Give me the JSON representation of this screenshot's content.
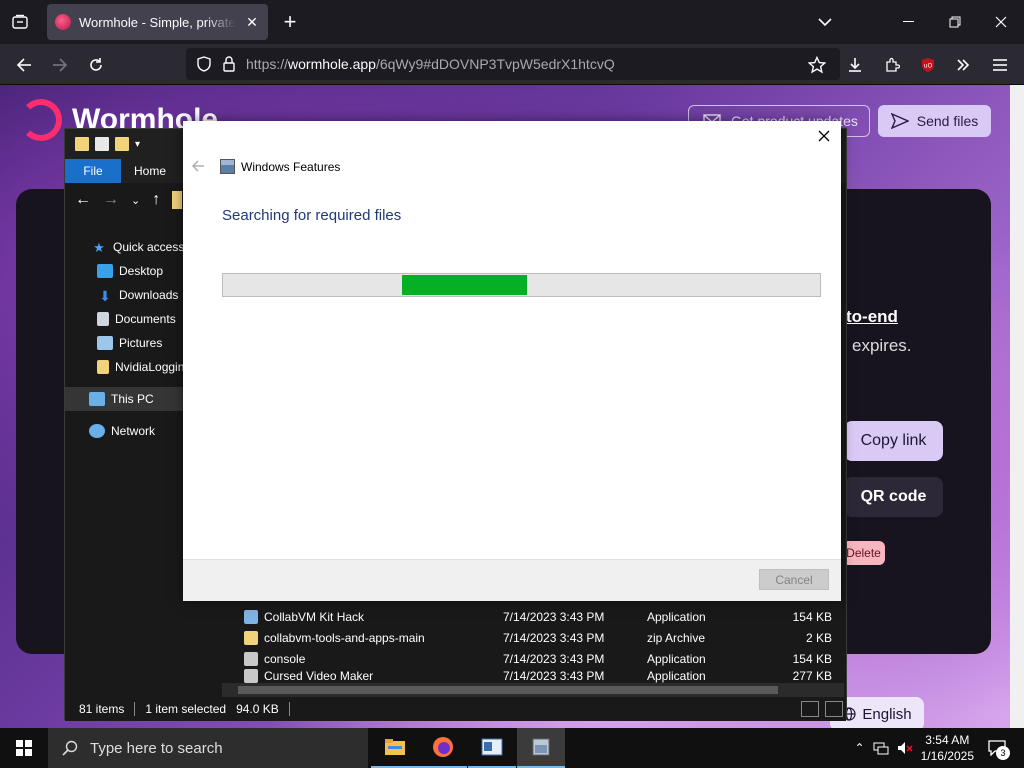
{
  "browser": {
    "tab": {
      "title": "Wormhole - Simple, private file sharing"
    },
    "url": {
      "scheme": "https://",
      "host": "wormhole.app",
      "path": "/6qWy9#dDOVNP3TvpW5edrX1htcvQ"
    }
  },
  "page": {
    "brand": "Wormhole",
    "updates_button": "Get product updates",
    "send_button": "Send files",
    "end_to_end_text": "to-end",
    "expires_text": "expires.",
    "copy_link_button": "Copy link",
    "qr_code_button": "QR code",
    "delete_button": "Delete",
    "language_button": "English"
  },
  "explorer": {
    "ribbon": {
      "file": "File",
      "home": "Home"
    },
    "sidebar": [
      {
        "label": "Quick access",
        "icon": "star-icon",
        "color": "#4aa3ff"
      },
      {
        "label": "Desktop",
        "icon": "desktop-icon",
        "color": "#3aa0e8"
      },
      {
        "label": "Downloads",
        "icon": "download-icon",
        "color": "#3a8ee8"
      },
      {
        "label": "Documents",
        "icon": "document-icon",
        "color": "#cfd6e0"
      },
      {
        "label": "Pictures",
        "icon": "picture-icon",
        "color": "#9cc6ea"
      },
      {
        "label": "NvidiaLogging",
        "icon": "folder-icon",
        "color": "#f2d27a"
      },
      {
        "label": "This PC",
        "icon": "computer-icon",
        "color": "#6ab0e8"
      },
      {
        "label": "Network",
        "icon": "network-icon",
        "color": "#6ab0e8"
      }
    ],
    "files": [
      {
        "name": "CollabVM Kit Hack",
        "date": "7/14/2023 3:43 PM",
        "type": "Application",
        "size": "154 KB",
        "color": "#7fb2e5"
      },
      {
        "name": "collabvm-tools-and-apps-main",
        "date": "7/14/2023 3:43 PM",
        "type": "zip Archive",
        "size": "2 KB",
        "color": "#f2d27a"
      },
      {
        "name": "console",
        "date": "7/14/2023 3:43 PM",
        "type": "Application",
        "size": "154 KB",
        "color": "#c8c8c8"
      },
      {
        "name": "Cursed Video Maker",
        "date": "7/14/2023 3:43 PM",
        "type": "Application",
        "size": "277 KB",
        "color": "#c8c8c8"
      }
    ],
    "status": {
      "items": "81 items",
      "selected": "1 item selected",
      "size": "94.0 KB"
    }
  },
  "dialog": {
    "title": "Windows Features",
    "status": "Searching for required files",
    "progress": {
      "start": 0.3,
      "end": 0.51
    },
    "cancel": "Cancel"
  },
  "taskbar": {
    "search_placeholder": "Type here to search",
    "time": "3:54 AM",
    "date": "1/16/2025",
    "notification_count": "3"
  }
}
